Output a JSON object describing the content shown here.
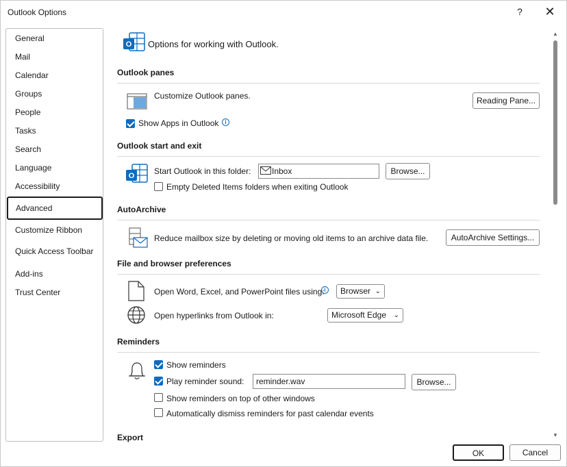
{
  "window": {
    "title": "Outlook Options",
    "help": "?",
    "close": "✕"
  },
  "nav": {
    "items": [
      "General",
      "Mail",
      "Calendar",
      "Groups",
      "People",
      "Tasks",
      "Search",
      "Language",
      "Accessibility",
      "Advanced",
      "Customize Ribbon",
      "Quick Access Toolbar",
      "Add-ins",
      "Trust Center"
    ],
    "selected": "Advanced"
  },
  "header": {
    "text": "Options for working with Outlook."
  },
  "panes": {
    "title": "Outlook panes",
    "customize_text": "Customize Outlook panes.",
    "reading_pane_button": "Reading Pane...",
    "show_apps_label": "Show Apps in Outlook",
    "show_apps_checked": true
  },
  "start_exit": {
    "title": "Outlook start and exit",
    "start_label": "Start Outlook in this folder:",
    "start_folder_value": "Inbox",
    "browse_button": "Browse...",
    "empty_deleted_label": "Empty Deleted Items folders when exiting Outlook",
    "empty_deleted_checked": false
  },
  "autoarchive": {
    "title": "AutoArchive",
    "description": "Reduce mailbox size by deleting or moving old items to an archive data file.",
    "settings_button": "AutoArchive Settings..."
  },
  "file_browser": {
    "title": "File and browser preferences",
    "open_files_label": "Open Word, Excel, and PowerPoint files using:",
    "open_files_value": "Browser",
    "hyperlinks_label": "Open hyperlinks from Outlook in:",
    "hyperlinks_value": "Microsoft Edge"
  },
  "reminders": {
    "title": "Reminders",
    "show_reminders_label": "Show reminders",
    "show_reminders_checked": true,
    "play_sound_label": "Play reminder sound:",
    "play_sound_checked": true,
    "sound_file_value": "reminder.wav",
    "browse_button": "Browse...",
    "on_top_label": "Show reminders on top of other windows",
    "on_top_checked": false,
    "auto_dismiss_label": "Automatically dismiss reminders for past calendar events",
    "auto_dismiss_checked": false
  },
  "export": {
    "title": "Export"
  },
  "footer": {
    "ok": "OK",
    "cancel": "Cancel"
  },
  "colors": {
    "accent": "#0f6cbd",
    "outlook_blue": "#0078d4"
  }
}
